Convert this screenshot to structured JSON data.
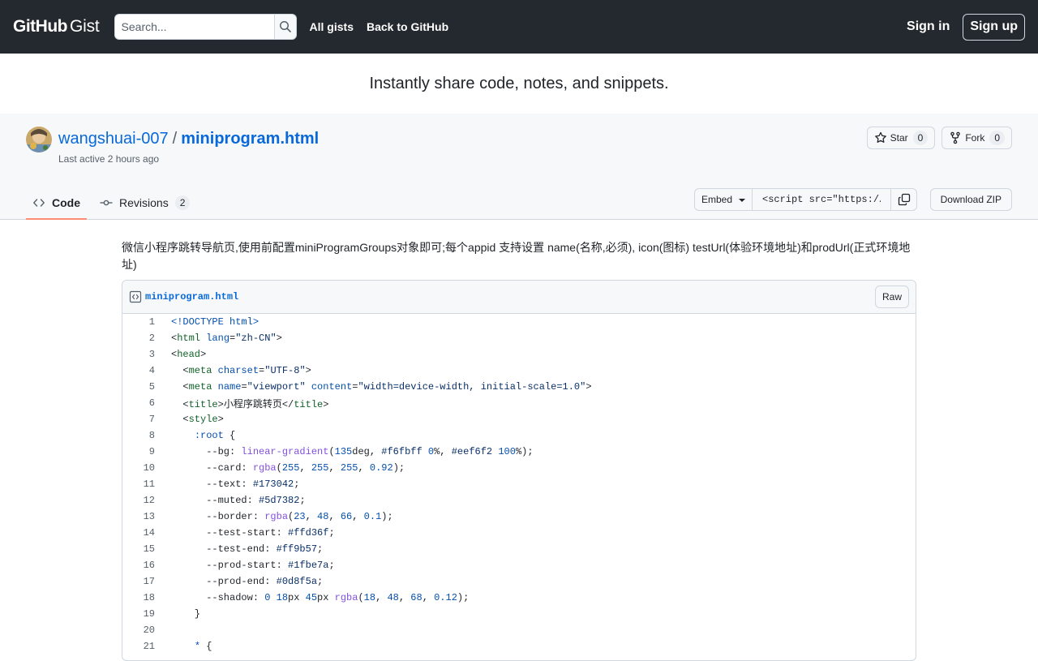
{
  "header": {
    "logo_bold": "GitHub",
    "logo_light": "Gist",
    "search_placeholder": "Search...",
    "nav": [
      "All gists",
      "Back to GitHub"
    ],
    "signin": "Sign in",
    "signup": "Sign up"
  },
  "tagline": "Instantly share code, notes, and snippets.",
  "gist": {
    "owner": "wangshuai-007",
    "separator": "/",
    "filename": "miniprogram.html",
    "last_active": "Last active 2 hours ago",
    "star_label": "Star",
    "star_count": "0",
    "fork_label": "Fork",
    "fork_count": "0"
  },
  "tabs": {
    "code_label": "Code",
    "revisions_label": "Revisions",
    "revisions_count": "2"
  },
  "embed": {
    "label": "Embed",
    "value": "<script src=\"https://"
  },
  "download_label": "Download ZIP",
  "description": "微信小程序跳转导航页,使用前配置miniProgramGroups对象即可;每个appid 支持设置 name(名称,必须), icon(图标) testUrl(体验环境地址)和prodUrl(正式环境地址)",
  "file": {
    "name": "miniprogram.html",
    "raw_label": "Raw"
  },
  "colors": {
    "header_bg": "#24292f",
    "link": "#0969da",
    "tab_underline": "#fd8c73"
  },
  "code_lines": [
    {
      "n": "1",
      "parts": [
        [
          "doc",
          "<!DOCTYPE html>"
        ]
      ]
    },
    {
      "n": "2",
      "parts": [
        [
          "",
          "<"
        ],
        [
          "tagname",
          "html"
        ],
        [
          "",
          " "
        ],
        [
          "attr",
          "lang"
        ],
        [
          "",
          "="
        ],
        [
          "str",
          "\"zh-CN\""
        ],
        [
          "",
          ">"
        ]
      ]
    },
    {
      "n": "3",
      "parts": [
        [
          "",
          "<"
        ],
        [
          "tagname",
          "head"
        ],
        [
          "",
          ">"
        ]
      ]
    },
    {
      "n": "4",
      "parts": [
        [
          "",
          "  <"
        ],
        [
          "tagname",
          "meta"
        ],
        [
          "",
          " "
        ],
        [
          "attr",
          "charset"
        ],
        [
          "",
          "="
        ],
        [
          "str",
          "\"UTF-8\""
        ],
        [
          "",
          ">"
        ]
      ]
    },
    {
      "n": "5",
      "parts": [
        [
          "",
          "  <"
        ],
        [
          "tagname",
          "meta"
        ],
        [
          "",
          " "
        ],
        [
          "attr",
          "name"
        ],
        [
          "",
          "="
        ],
        [
          "str",
          "\"viewport\""
        ],
        [
          "",
          " "
        ],
        [
          "attr",
          "content"
        ],
        [
          "",
          "="
        ],
        [
          "str",
          "\"width=device-width, initial-scale=1.0\""
        ],
        [
          "",
          ">"
        ]
      ]
    },
    {
      "n": "6",
      "parts": [
        [
          "",
          "  <"
        ],
        [
          "tagname",
          "title"
        ],
        [
          "",
          ">小程序跳转页</"
        ],
        [
          "tagname",
          "title"
        ],
        [
          "",
          ">"
        ]
      ]
    },
    {
      "n": "7",
      "parts": [
        [
          "",
          "  <"
        ],
        [
          "tagname",
          "style"
        ],
        [
          "",
          ">"
        ]
      ]
    },
    {
      "n": "8",
      "parts": [
        [
          "",
          "    "
        ],
        [
          "sel",
          ":root"
        ],
        [
          "",
          " {"
        ]
      ]
    },
    {
      "n": "9",
      "parts": [
        [
          "",
          "      --bg: "
        ],
        [
          "fn",
          "linear-gradient"
        ],
        [
          "",
          "("
        ],
        [
          "num",
          "135"
        ],
        [
          "",
          "deg, "
        ],
        [
          "str",
          "#f6fbff"
        ],
        [
          "",
          " "
        ],
        [
          "num",
          "0"
        ],
        [
          "",
          "%, "
        ],
        [
          "str",
          "#eef6f2"
        ],
        [
          "",
          " "
        ],
        [
          "num",
          "100"
        ],
        [
          "",
          "%);"
        ]
      ]
    },
    {
      "n": "10",
      "parts": [
        [
          "",
          "      --card: "
        ],
        [
          "fn",
          "rgba"
        ],
        [
          "",
          "("
        ],
        [
          "num",
          "255"
        ],
        [
          "",
          ", "
        ],
        [
          "num",
          "255"
        ],
        [
          "",
          ", "
        ],
        [
          "num",
          "255"
        ],
        [
          "",
          ", "
        ],
        [
          "num",
          "0.92"
        ],
        [
          "",
          ");"
        ]
      ]
    },
    {
      "n": "11",
      "parts": [
        [
          "",
          "      --text: "
        ],
        [
          "str",
          "#173042"
        ],
        [
          "",
          ";"
        ]
      ]
    },
    {
      "n": "12",
      "parts": [
        [
          "",
          "      --muted: "
        ],
        [
          "str",
          "#5d7382"
        ],
        [
          "",
          ";"
        ]
      ]
    },
    {
      "n": "13",
      "parts": [
        [
          "",
          "      --border: "
        ],
        [
          "fn",
          "rgba"
        ],
        [
          "",
          "("
        ],
        [
          "num",
          "23"
        ],
        [
          "",
          ", "
        ],
        [
          "num",
          "48"
        ],
        [
          "",
          ", "
        ],
        [
          "num",
          "66"
        ],
        [
          "",
          ", "
        ],
        [
          "num",
          "0.1"
        ],
        [
          "",
          ");"
        ]
      ]
    },
    {
      "n": "14",
      "parts": [
        [
          "",
          "      --test-start: "
        ],
        [
          "str",
          "#ffd36f"
        ],
        [
          "",
          ";"
        ]
      ]
    },
    {
      "n": "15",
      "parts": [
        [
          "",
          "      --test-end: "
        ],
        [
          "str",
          "#ff9b57"
        ],
        [
          "",
          ";"
        ]
      ]
    },
    {
      "n": "16",
      "parts": [
        [
          "",
          "      --prod-start: "
        ],
        [
          "str",
          "#1fbe7a"
        ],
        [
          "",
          ";"
        ]
      ]
    },
    {
      "n": "17",
      "parts": [
        [
          "",
          "      --prod-end: "
        ],
        [
          "str",
          "#0d8f5a"
        ],
        [
          "",
          ";"
        ]
      ]
    },
    {
      "n": "18",
      "parts": [
        [
          "",
          "      --shadow: "
        ],
        [
          "num",
          "0"
        ],
        [
          "",
          " "
        ],
        [
          "num",
          "18"
        ],
        [
          "",
          "px "
        ],
        [
          "num",
          "45"
        ],
        [
          "",
          "px "
        ],
        [
          "fn",
          "rgba"
        ],
        [
          "",
          "("
        ],
        [
          "num",
          "18"
        ],
        [
          "",
          ", "
        ],
        [
          "num",
          "48"
        ],
        [
          "",
          ", "
        ],
        [
          "num",
          "68"
        ],
        [
          "",
          ", "
        ],
        [
          "num",
          "0.12"
        ],
        [
          "",
          ");"
        ]
      ]
    },
    {
      "n": "19",
      "parts": [
        [
          "",
          "    }"
        ]
      ]
    },
    {
      "n": "20",
      "parts": [
        [
          "",
          ""
        ]
      ]
    },
    {
      "n": "21",
      "parts": [
        [
          "",
          "    "
        ],
        [
          "sel",
          "*"
        ],
        [
          "",
          " {"
        ]
      ]
    }
  ]
}
